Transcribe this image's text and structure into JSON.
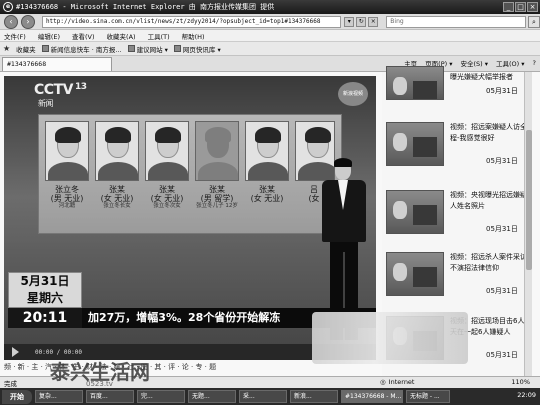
{
  "window": {
    "title": "#134376668 - Microsoft Internet Explorer 由 南方报业传媒集团 提供",
    "controls": [
      "_",
      "□",
      "×"
    ]
  },
  "address": {
    "url": "http://video.sina.com.cn/vlist/news/zt/zdyy2014/?opsubject_id=top1#134376668",
    "search_placeholder": "Bing",
    "go": "→"
  },
  "menu": [
    "文件(F)",
    "编辑(E)",
    "查看(V)",
    "收藏夹(A)",
    "工具(T)",
    "帮助(H)"
  ],
  "favorites": {
    "label": "收藏夹",
    "items": [
      "新闻信息快车 · 南方报...",
      "建议网站 ▾",
      "网页快讯库 ▾"
    ]
  },
  "tab": {
    "label": "#134376668"
  },
  "commands": [
    "主页",
    "页面(P) ▾",
    "安全(S) ▾",
    "工具(O) ▾",
    "?"
  ],
  "video": {
    "channel": "CCTV",
    "channel_num": "13",
    "program": "新闻",
    "sina": "新浪视频",
    "suspects": [
      {
        "name": "张立冬",
        "desc": "(男 无业)",
        "sub": "河北籍"
      },
      {
        "name": "张某",
        "desc": "(女 无业)",
        "sub": "张立冬长女"
      },
      {
        "name": "张某",
        "desc": "(女 无业)",
        "sub": "张立冬次女"
      },
      {
        "name": "张某",
        "desc": "(男 留学)",
        "sub": "张立冬儿子 12岁"
      },
      {
        "name": "张某",
        "desc": "(女 无业)",
        "sub": ""
      },
      {
        "name": "吕",
        "desc": "(女",
        "sub": ""
      }
    ],
    "date_line1": "5月31日",
    "date_line2": "星期六",
    "time": "20:11",
    "ticker": "加27万，增幅3%。28个省份开始解冻",
    "timecode": "00:00 / 00:00"
  },
  "sidebar": {
    "top_snippet": "曝光嫌疑犬幅举报者",
    "top_date": "05月31日",
    "items": [
      {
        "title": "视频：招远案嫌疑人访全程-我感觉很好",
        "date": "05月31日"
      },
      {
        "title": "视频：央视曝光招远嫌疑人姓名照片",
        "date": "05月31日"
      },
      {
        "title": "视频：招远杀人案件采访-不演招法律信仰",
        "date": "05月31日"
      },
      {
        "title": "视频：招远现场目击6人当天在一起6人嫌疑人",
        "date": "05月31日"
      }
    ]
  },
  "bottom_links": "频 · 新 · 主 · 汽 · 体 · 生 · 财 · 法 · 娱 · 社 · 图 · 其 · 评 · 论 · 专 · 题",
  "status": {
    "left": "完成",
    "zone": "Internet",
    "zoom": "110%"
  },
  "taskbar": {
    "start": "开始",
    "tasks": [
      "复杂...",
      "百度...",
      "完...",
      "无题...",
      "采...",
      "新浪...",
      "#134376668 - M...",
      "无标题 - ..."
    ],
    "clock": "22:09"
  },
  "watermark": {
    "text": "泰兴生活网",
    "url": "0523.tv"
  }
}
